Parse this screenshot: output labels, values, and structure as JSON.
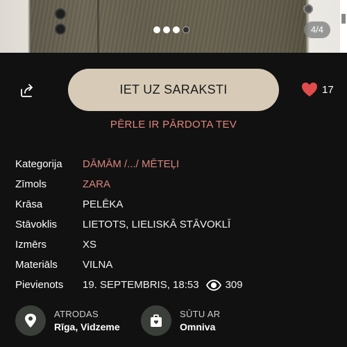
{
  "gallery": {
    "counter": "4/4",
    "dots_total": 4,
    "active_dot_index": 3
  },
  "actions": {
    "share_icon": "share-icon",
    "primary_button": "IET UZ SARAKSTI",
    "favorite_icon": "heart-icon",
    "favorite_count": "17",
    "favorite_color": "#e14b4b"
  },
  "sold_note": "PĒRLE IR PĀRDOTA TEV",
  "details": [
    {
      "label": "Kategorija",
      "value": "DĀMĀM /.../ MĒTEĻI",
      "link": true
    },
    {
      "label": "Zīmols",
      "value": "ZARA",
      "link": true
    },
    {
      "label": "Krāsa",
      "value": "PELĒKA",
      "link": false
    },
    {
      "label": "Stāvoklis",
      "value": "LIETOTS, LIELISKĀ STĀVOKLĪ",
      "link": false
    },
    {
      "label": "Izmērs",
      "value": "XS",
      "link": false
    },
    {
      "label": "Materiāls",
      "value": "VILNA",
      "link": false
    },
    {
      "label": "Pievienots",
      "value": "19. SEPTEMBRIS, 18:53",
      "link": false
    }
  ],
  "views_count": "309",
  "location": {
    "label": "ATRODAS",
    "value": "Rīga, Vidzeme",
    "icon": "location-pin-icon"
  },
  "shipping": {
    "label": "SŪTU AR",
    "value": "Omniva",
    "icon": "package-icon"
  },
  "colors": {
    "button_bg": "#d7cbb7",
    "accent": "#d9867e",
    "background": "#111111"
  }
}
